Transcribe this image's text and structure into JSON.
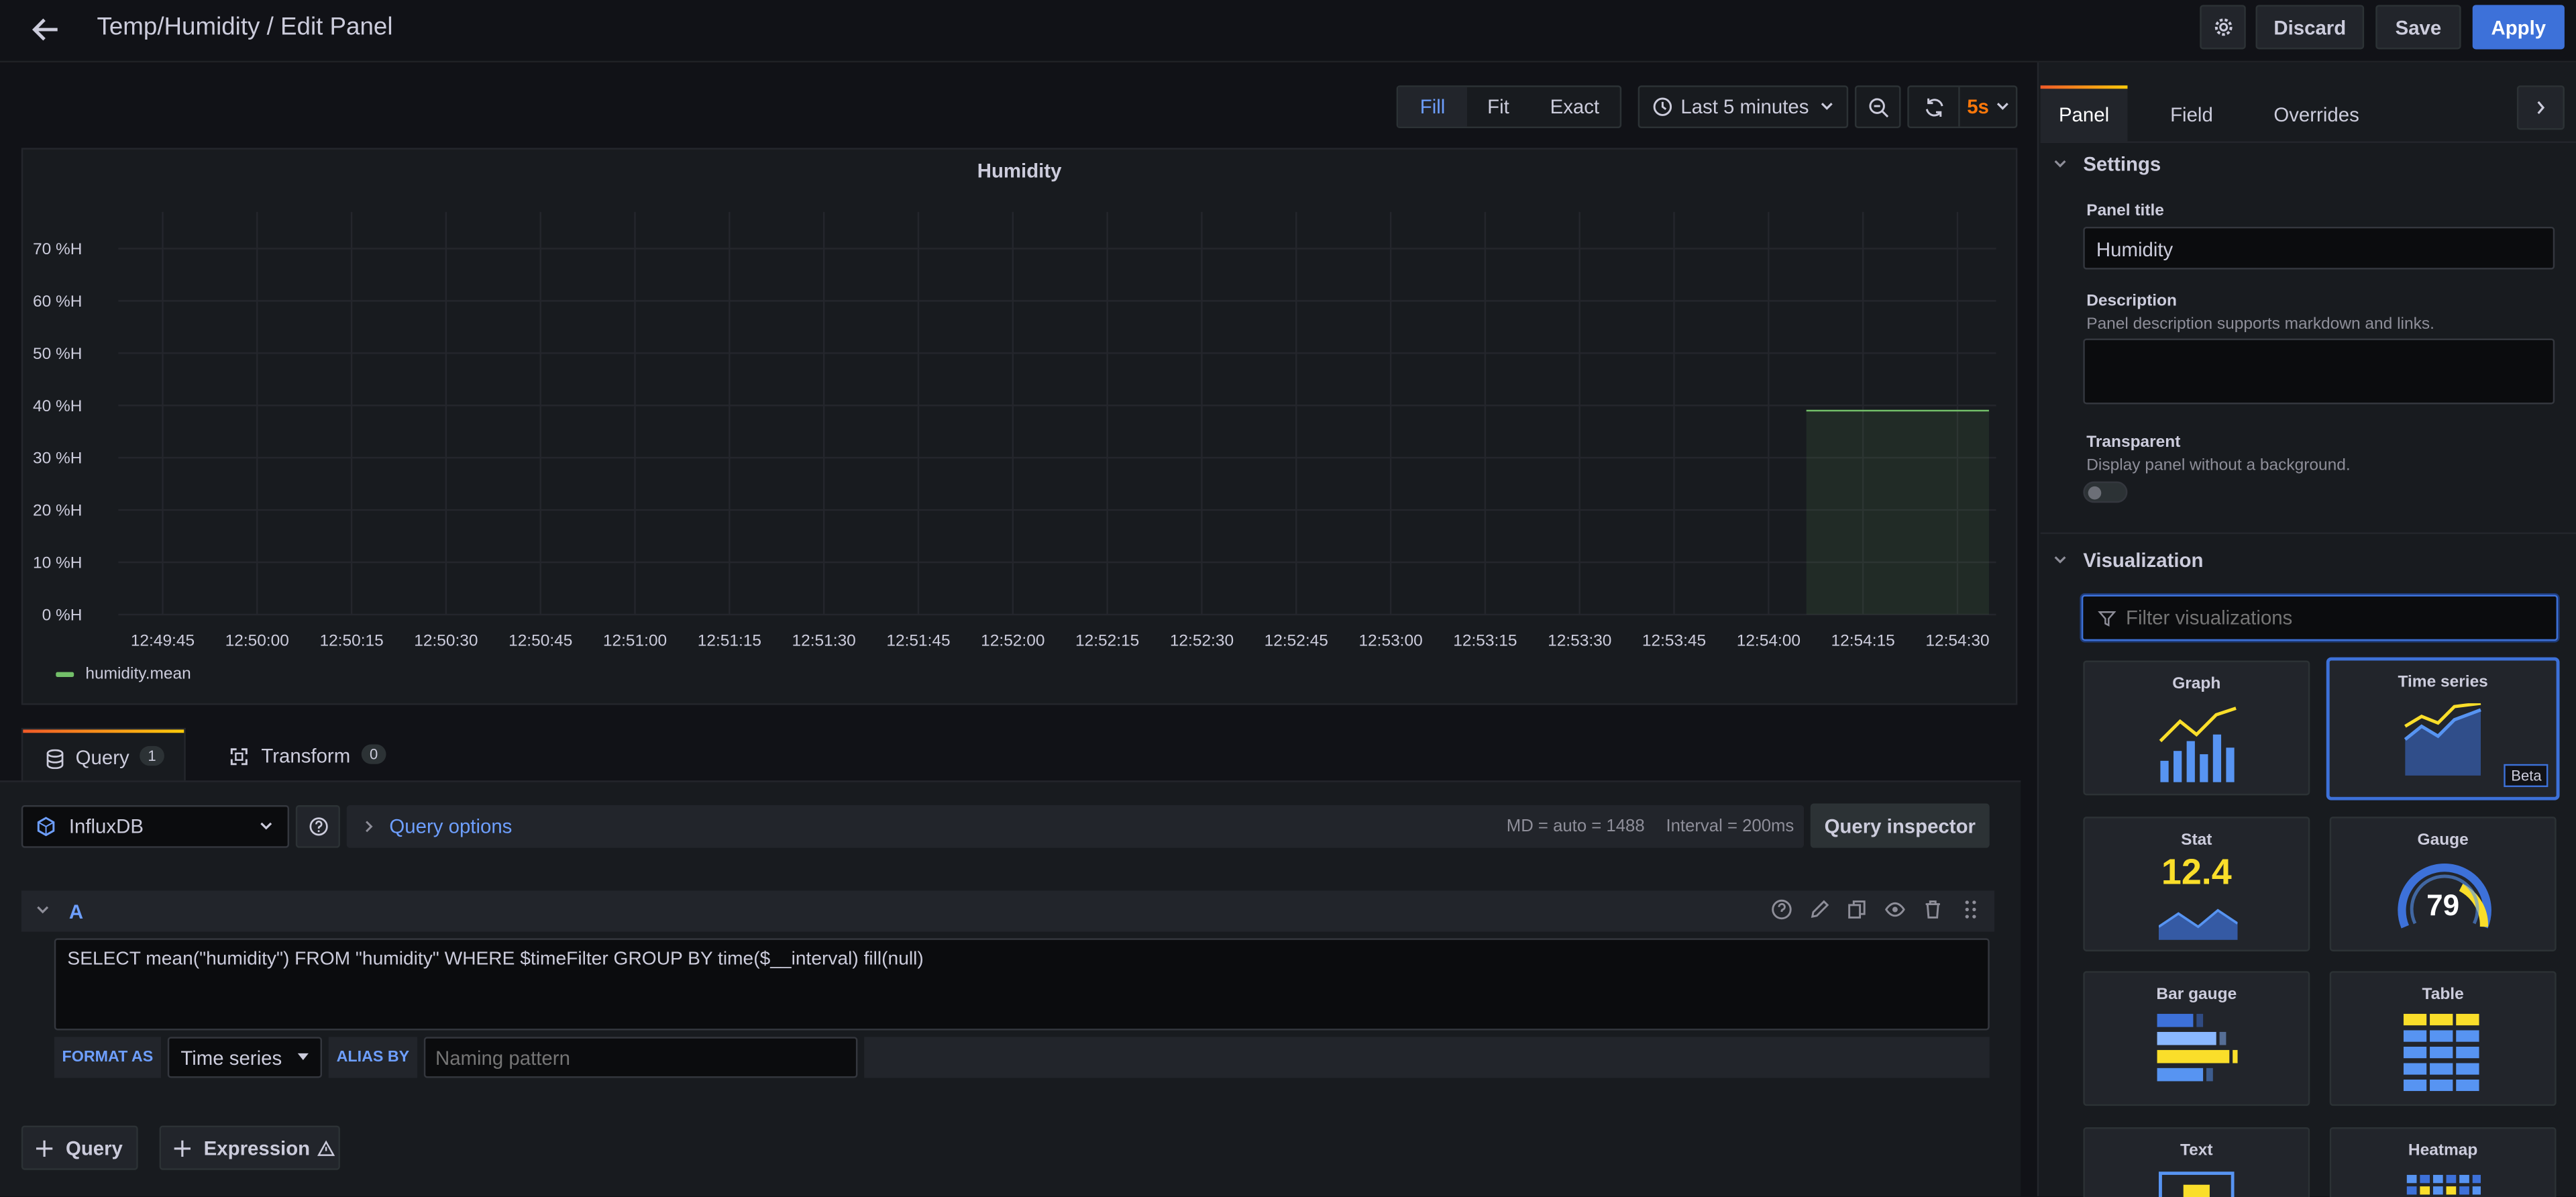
{
  "header": {
    "title": "Temp/Humidity / Edit Panel",
    "discard_label": "Discard",
    "save_label": "Save",
    "apply_label": "Apply"
  },
  "toolbar": {
    "fill_label": "Fill",
    "fit_label": "Fit",
    "exact_label": "Exact",
    "time_range": "Last 5 minutes",
    "refresh_interval": "5s"
  },
  "chart_data": {
    "type": "line",
    "title": "Humidity",
    "x": [
      "12:49:45",
      "12:50:00",
      "12:50:15",
      "12:50:30",
      "12:50:45",
      "12:51:00",
      "12:51:15",
      "12:51:30",
      "12:51:45",
      "12:52:00",
      "12:52:15",
      "12:52:30",
      "12:52:45",
      "12:53:00",
      "12:53:15",
      "12:53:30",
      "12:53:45",
      "12:54:00",
      "12:54:15",
      "12:54:30"
    ],
    "y_ticks": [
      "70 %H",
      "60 %H",
      "50 %H",
      "40 %H",
      "30 %H",
      "20 %H",
      "10 %H",
      "0 %H"
    ],
    "ylim": [
      0,
      77
    ],
    "series": [
      {
        "name": "humidity.mean",
        "color": "#73bf69",
        "points": [
          [
            "12:54:06",
            39
          ],
          [
            "12:54:35",
            39
          ]
        ]
      }
    ],
    "legend_placement": "bottom-left",
    "grid": true
  },
  "query_tabs": {
    "query_label": "Query",
    "query_count": "1",
    "transform_label": "Transform",
    "transform_count": "0"
  },
  "datasource": {
    "name": "InfluxDB",
    "query_options_label": "Query options",
    "md_info": "MD = auto = 1488",
    "interval_info": "Interval = 200ms",
    "inspector_label": "Query inspector"
  },
  "query_a": {
    "ref": "A",
    "sql": "SELECT mean(\"humidity\") FROM \"humidity\" WHERE $timeFilter GROUP BY time($__interval) fill(null)",
    "format_as_label": "FORMAT AS",
    "format_value": "Time series",
    "alias_by_label": "ALIAS BY",
    "alias_placeholder": "Naming pattern"
  },
  "bottom_buttons": {
    "add_query": "Query",
    "add_expression": "Expression"
  },
  "side_tabs": [
    "Panel",
    "Field",
    "Overrides"
  ],
  "settings": {
    "section_title": "Settings",
    "panel_title_label": "Panel title",
    "panel_title_value": "Humidity",
    "description_label": "Description",
    "description_help": "Panel description supports markdown and links.",
    "transparent_label": "Transparent",
    "transparent_help": "Display panel without a background."
  },
  "visualization": {
    "section_title": "Visualization",
    "filter_placeholder": "Filter visualizations",
    "cards": [
      {
        "name": "Graph"
      },
      {
        "name": "Time series",
        "badge": "Beta"
      },
      {
        "name": "Stat",
        "value": "12.4"
      },
      {
        "name": "Gauge",
        "value": "79"
      },
      {
        "name": "Bar gauge"
      },
      {
        "name": "Table"
      },
      {
        "name": "Text"
      },
      {
        "name": "Heatmap"
      }
    ]
  }
}
